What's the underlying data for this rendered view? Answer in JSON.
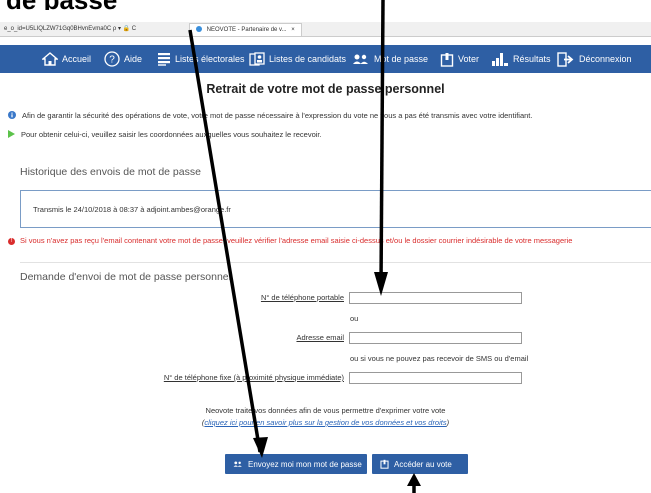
{
  "caption": "de passe",
  "browser": {
    "url": "e_o_id=U5LIQLZW71Gq0BHvnEvma0C ρ ▾ 🔒 C",
    "tab_title": "NEOVOTE - Partenaire de v...",
    "tab_close": "×"
  },
  "nav": {
    "items": [
      {
        "label": "Accueil",
        "icon": "home-icon"
      },
      {
        "label": "Aide",
        "icon": "help-icon"
      },
      {
        "label": "Listes électorales",
        "icon": "list-icon"
      },
      {
        "label": "Listes de candidats",
        "icon": "candidates-icon"
      },
      {
        "label": "Mot de passe",
        "icon": "key-icon"
      },
      {
        "label": "Voter",
        "icon": "vote-icon"
      },
      {
        "label": "Résultats",
        "icon": "results-icon"
      },
      {
        "label": "Déconnexion",
        "icon": "logout-icon"
      }
    ]
  },
  "page": {
    "title": "Retrait de votre mot de passe personnel",
    "info1": "Afin de garantir la sécurité des opérations de vote, votre mot de passe nécessaire à l'expression du vote ne vous a pas été transmis avec votre identifiant.",
    "info2": "Pour obtenir celui-ci, veuillez saisir les coordonnées auxquelles vous souhaitez le recevoir."
  },
  "history": {
    "title": "Historique des envois de mot de passe",
    "entry": "Transmis le 24/10/2018 à 08:37 à adjoint.ambes@orange.fr"
  },
  "warning": "Si vous n'avez pas reçu l'email contenant votre mot de passe, veuillez vérifier l'adresse email saisie ci-dessus et/ou le dossier courrier indésirable de votre messagerie",
  "form": {
    "title": "Demande d'envoi de mot de passe personnel",
    "mobile_label": "N° de téléphone portable",
    "mobile_value": "",
    "or1": "ou",
    "email_label": "Adresse email",
    "email_value": "",
    "or2": "ou si vous ne pouvez pas recevoir de SMS ou d'email",
    "landline_label": "N° de téléphone fixe (à proximité physique immédiate)",
    "landline_value": ""
  },
  "privacy": {
    "text": "Neovote traite vos données afin de vous permettre d'exprimer votre vote",
    "link_open": "(",
    "link": "cliquez ici pour en savoir plus sur la gestion de vos données et vos droits",
    "link_close": ")"
  },
  "buttons": {
    "send": "Envoyez moi mon mot de passe",
    "access": "Accéder au vote"
  },
  "colors": {
    "nav_bg": "#2e5fa4",
    "warning": "#d92c2c",
    "info_icon": "#3a78c9",
    "arrow_icon": "#5cc24a"
  }
}
